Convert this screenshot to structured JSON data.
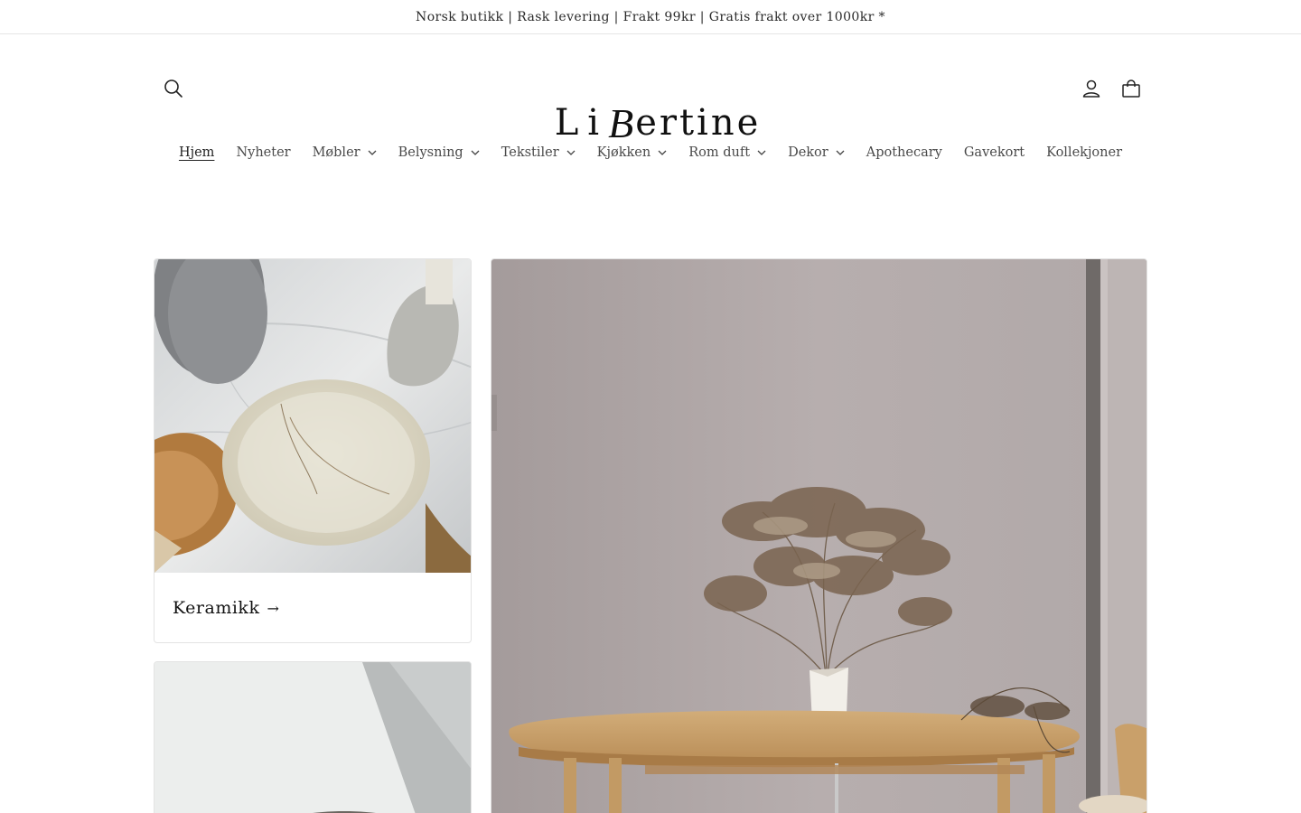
{
  "announcement": {
    "text": "Norsk butikk | Rask levering | Frakt 99kr | Gratis frakt over 1000kr *"
  },
  "header": {
    "logo_text_part1": "Li",
    "logo_text_b": "B",
    "logo_text_part2": "ertine",
    "icons": {
      "search": "search-icon",
      "account": "account-icon",
      "cart": "cart-icon"
    }
  },
  "nav": {
    "items": [
      {
        "label": "Hjem",
        "dropdown": false,
        "active": true
      },
      {
        "label": "Nyheter",
        "dropdown": false
      },
      {
        "label": "Møbler",
        "dropdown": true
      },
      {
        "label": "Belysning",
        "dropdown": true
      },
      {
        "label": "Tekstiler",
        "dropdown": true
      },
      {
        "label": "Kjøkken",
        "dropdown": true
      },
      {
        "label": "Rom duft",
        "dropdown": true
      },
      {
        "label": "Dekor",
        "dropdown": true
      },
      {
        "label": "Apothecary",
        "dropdown": false
      },
      {
        "label": "Gavekort",
        "dropdown": false
      },
      {
        "label": "Kollekjoner",
        "dropdown": false
      }
    ]
  },
  "collections": {
    "card1": {
      "title": "Keramikk",
      "arrow": "→"
    }
  },
  "colors": {
    "text": "#121212",
    "nav_text": "#4a4a4a",
    "border": "#e3e3e3",
    "wall": "#b7aeae",
    "wood": "#c9a46f"
  }
}
